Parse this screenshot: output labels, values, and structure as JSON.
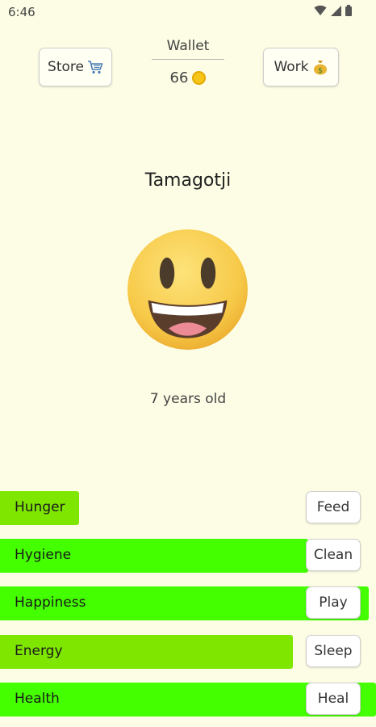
{
  "status_bar": {
    "time": "6:46",
    "icons": [
      "wifi-icon",
      "signal-icon",
      "battery-icon"
    ]
  },
  "header": {
    "store_label": "Store",
    "store_icon": "cart-icon",
    "work_label": "Work",
    "work_icon": "money-bag-icon",
    "wallet_title": "Wallet",
    "wallet_amount": "66",
    "wallet_icon": "coin-icon"
  },
  "pet": {
    "name": "Tamagotji",
    "face_icon": "grinning-face-icon",
    "age_text": "7 years old"
  },
  "colors": {
    "background": "#fdfde5",
    "bar_bright": "#44ff00",
    "bar_medium": "#7fe600"
  },
  "stats": [
    {
      "label": "Hunger",
      "action": "Feed",
      "level": 0.21,
      "color": "#7fe600"
    },
    {
      "label": "Hygiene",
      "action": "Clean",
      "level": 0.82,
      "color": "#44ff00"
    },
    {
      "label": "Happiness",
      "action": "Play",
      "level": 0.98,
      "color": "#44ff00"
    },
    {
      "label": "Energy",
      "action": "Sleep",
      "level": 0.78,
      "color": "#7fe600"
    },
    {
      "label": "Health",
      "action": "Heal",
      "level": 1.0,
      "color": "#44ff00"
    }
  ]
}
